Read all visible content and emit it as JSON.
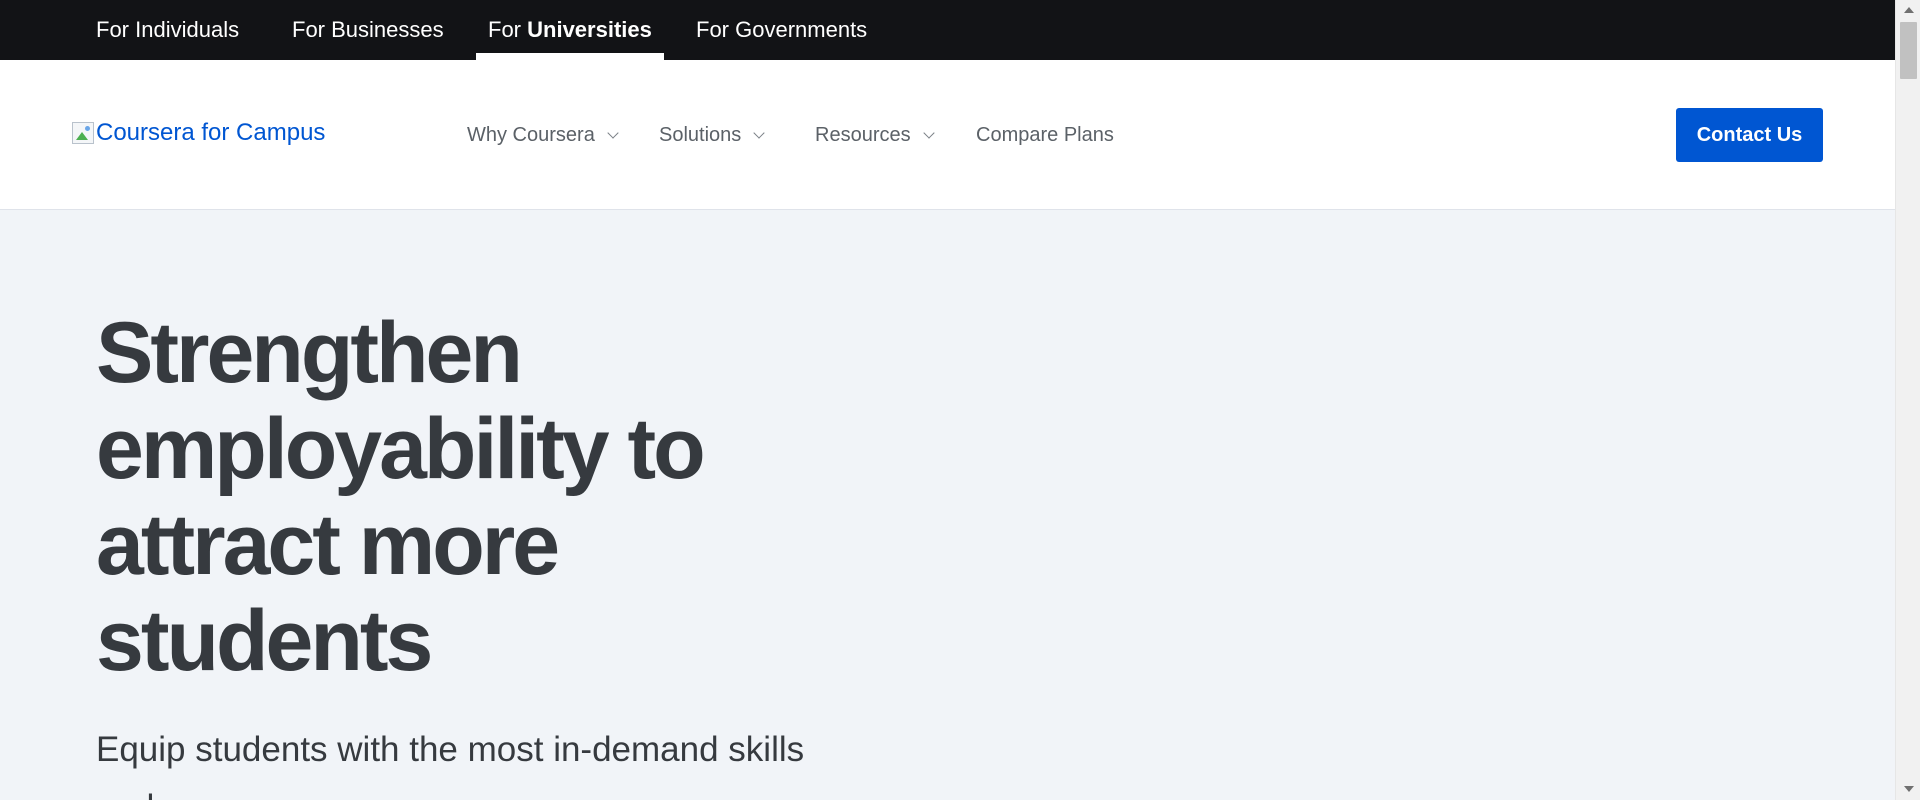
{
  "audience_nav": {
    "items": [
      {
        "prefix": "For",
        "emphasis": "",
        "label": "Individuals"
      },
      {
        "prefix": "For",
        "emphasis": "",
        "label": "Businesses"
      },
      {
        "prefix": "For",
        "emphasis": "Universities",
        "label": ""
      },
      {
        "prefix": "For",
        "emphasis": "",
        "label": "Governments"
      }
    ],
    "active_index": 2
  },
  "header": {
    "logo_alt": "Coursera for Campus",
    "nav": [
      {
        "label": "Why Coursera",
        "has_dropdown": true
      },
      {
        "label": "Solutions",
        "has_dropdown": true
      },
      {
        "label": "Resources",
        "has_dropdown": true
      },
      {
        "label": "Compare Plans",
        "has_dropdown": false
      }
    ],
    "contact_button": "Contact Us"
  },
  "hero": {
    "title_lines": [
      "Strengthen",
      "employability to",
      "attract more",
      "students"
    ],
    "subtitle_line": "Equip students with the most in-demand skills and"
  },
  "colors": {
    "top_bar": "#121316",
    "brand_blue": "#0056d2",
    "hero_bg": "#f1f4f8",
    "text_dark": "#363a3f",
    "nav_text": "#5b6167"
  },
  "icons": {
    "broken_logo_image": "broken-image-icon",
    "dropdown": "chevron-down-icon",
    "scroll_up": "scroll-up-arrow-icon",
    "scroll_down": "scroll-down-arrow-icon"
  }
}
